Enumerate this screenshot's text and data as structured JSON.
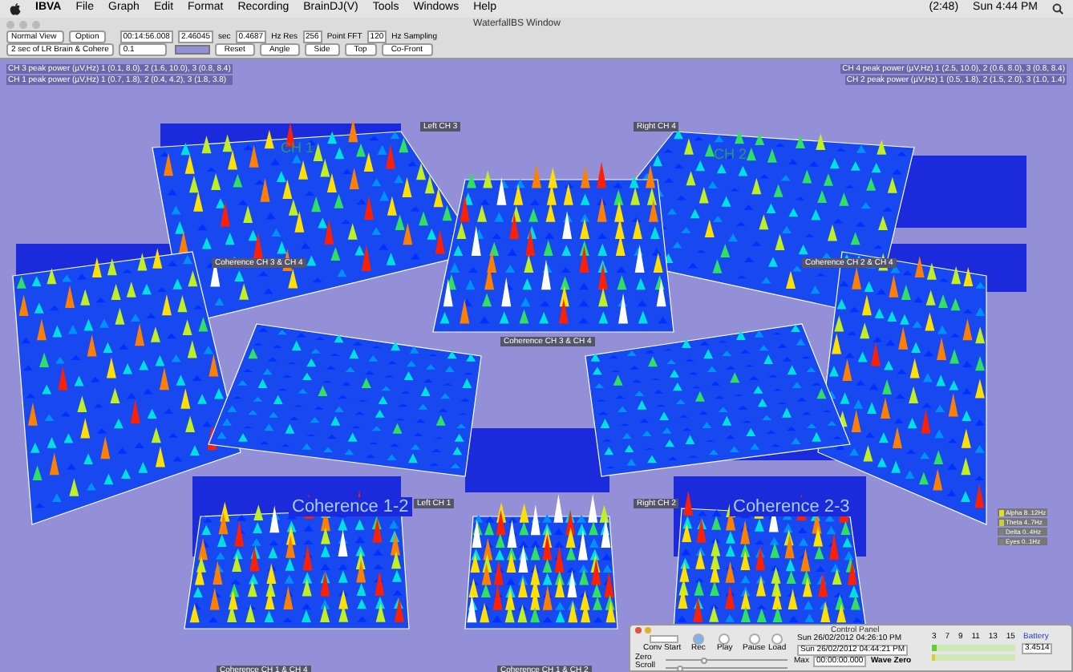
{
  "menu_bar": {
    "items": [
      "IBVA",
      "File",
      "Graph",
      "Edit",
      "Format",
      "Recording",
      "BrainDJ(V)",
      "Tools",
      "Windows",
      "Help"
    ],
    "battery_time": "(2:48)",
    "clock": "Sun 4:44 PM"
  },
  "window": {
    "title": "WaterfallBS Window"
  },
  "toolbar": {
    "view_select": "Normal View",
    "option_button": "Option",
    "time_field": "00:14:56.008",
    "fields": [
      {
        "value": "2.46045",
        "unit": "sec"
      },
      {
        "value": "0.4687",
        "unit": "Hz Res"
      },
      {
        "value": "256",
        "unit": "Point FFT"
      },
      {
        "value": "120",
        "unit": "Hz Sampling"
      }
    ],
    "preset_select": "2 sec of LR Brain & Cohere",
    "scale_select": "0.1",
    "buttons": [
      "Reset",
      "Angle",
      "Side",
      "Top",
      "Co-Front"
    ]
  },
  "peak_readouts": {
    "left": [
      "CH 3 peak power (µV,Hz) 1 (0.1, 8.0), 2 (1.6, 10.0), 3 (0.8, 8.4)",
      "CH 1 peak power (µV,Hz) 1 (0.7, 1.8), 2 (0.4, 4.2), 3 (1.8, 3.8)"
    ],
    "right": [
      "CH 4 peak power (µV,Hz) 1 (2.5, 10.0), 2 (0.6, 8.0), 3 (0.8, 8.4)",
      "CH 2 peak power (µV,Hz) 1 (0.5, 1.8), 2 (1.5, 2.0), 3 (1.0, 1.4)"
    ]
  },
  "plot_labels": [
    {
      "text": "Left CH 3",
      "kind": "small"
    },
    {
      "text": "Right CH 4",
      "kind": "small"
    },
    {
      "text": "CH 1",
      "kind": "channel"
    },
    {
      "text": "CH 2",
      "kind": "channel"
    },
    {
      "text": "Coherence CH 3 & CH 4",
      "kind": "small"
    },
    {
      "text": "Coherence CH 2 & CH 4",
      "kind": "small"
    },
    {
      "text": "Coherence CH 3 & CH 4",
      "kind": "small"
    },
    {
      "text": "Coherence 1-2",
      "kind": "big"
    },
    {
      "text": "Left CH 1",
      "kind": "small"
    },
    {
      "text": "Right CH 2",
      "kind": "small"
    },
    {
      "text": "Coherence 2-3",
      "kind": "big"
    },
    {
      "text": "Coherence CH 1 & CH 4",
      "kind": "small"
    },
    {
      "text": "Coherence CH 1 & CH 2",
      "kind": "small"
    }
  ],
  "legend": [
    {
      "label": "Alpha 8..12Hz",
      "color": "#e0e020"
    },
    {
      "label": "Theta 4..7Hz",
      "color": "#c0d040"
    },
    {
      "label": "Delta 0..4Hz",
      "color": "#808080"
    },
    {
      "label": "Eyes 0..1Hz",
      "color": "#808080"
    }
  ],
  "control_panel": {
    "title": "Control Panel",
    "conv_start": "Conv Start",
    "transport": [
      {
        "label": "Rec",
        "selected": true
      },
      {
        "label": "Play",
        "selected": false
      },
      {
        "label": "Pause",
        "selected": false
      },
      {
        "label": "Load",
        "selected": false
      }
    ],
    "start_time": "Sun 26/02/2012 04:26:10 PM",
    "end_time": "Sun 26/02/2012 04:44:21 PM",
    "sliders": [
      {
        "label": "Zero",
        "level": 0.3
      },
      {
        "label": "Scroll",
        "level": 0.1
      }
    ],
    "max_label": "Max",
    "max_value": "00:00:00.000",
    "wave_zero": "Wave Zero",
    "scale_ticks": [
      "3",
      "7",
      "9",
      "11",
      "13",
      "15"
    ],
    "meters": [
      {
        "level": 0.06,
        "color": "#66cc33"
      },
      {
        "level": 0.04,
        "color": "#ddcc33"
      }
    ],
    "battery_label": "Battery",
    "battery_value": "3.4514"
  }
}
